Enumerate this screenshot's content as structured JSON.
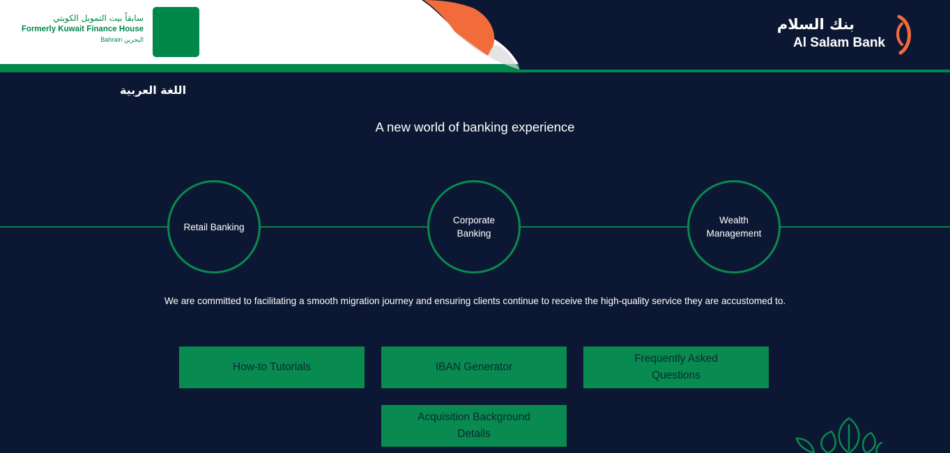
{
  "header": {
    "kfh_arabic": "سابقاً بيت التمويل الكويتي",
    "kfh_formerly": "Formerly Kuwait Finance House",
    "kfh_bahrain": "Bahrain البحرين",
    "brand_arabic": "بنك السلام",
    "brand_english": "Al Salam Bank",
    "colors": {
      "brand_green": "#00874a",
      "accent_orange": "#f26b3a",
      "background_navy": "#0c1833"
    }
  },
  "language_link": "اللغة العربية",
  "tagline": "A new world of banking experience",
  "segments": [
    {
      "label": "Retail Banking"
    },
    {
      "label": "Corporate Banking"
    },
    {
      "label": "Wealth Management"
    }
  ],
  "statement": "We are committed to facilitating a smooth migration journey and ensuring clients continue to receive the high-quality service they are accustomed to.",
  "actions": [
    {
      "label": "How-to Tutorials"
    },
    {
      "label": "IBAN Generator"
    },
    {
      "label": "Frequently Asked Questions"
    },
    {
      "label": "Acquisition Background Details"
    }
  ],
  "icons": [
    "kfh-logo-icon",
    "page-curl-icon",
    "alsalam-logo-icon",
    "plant-leaves-icon"
  ]
}
